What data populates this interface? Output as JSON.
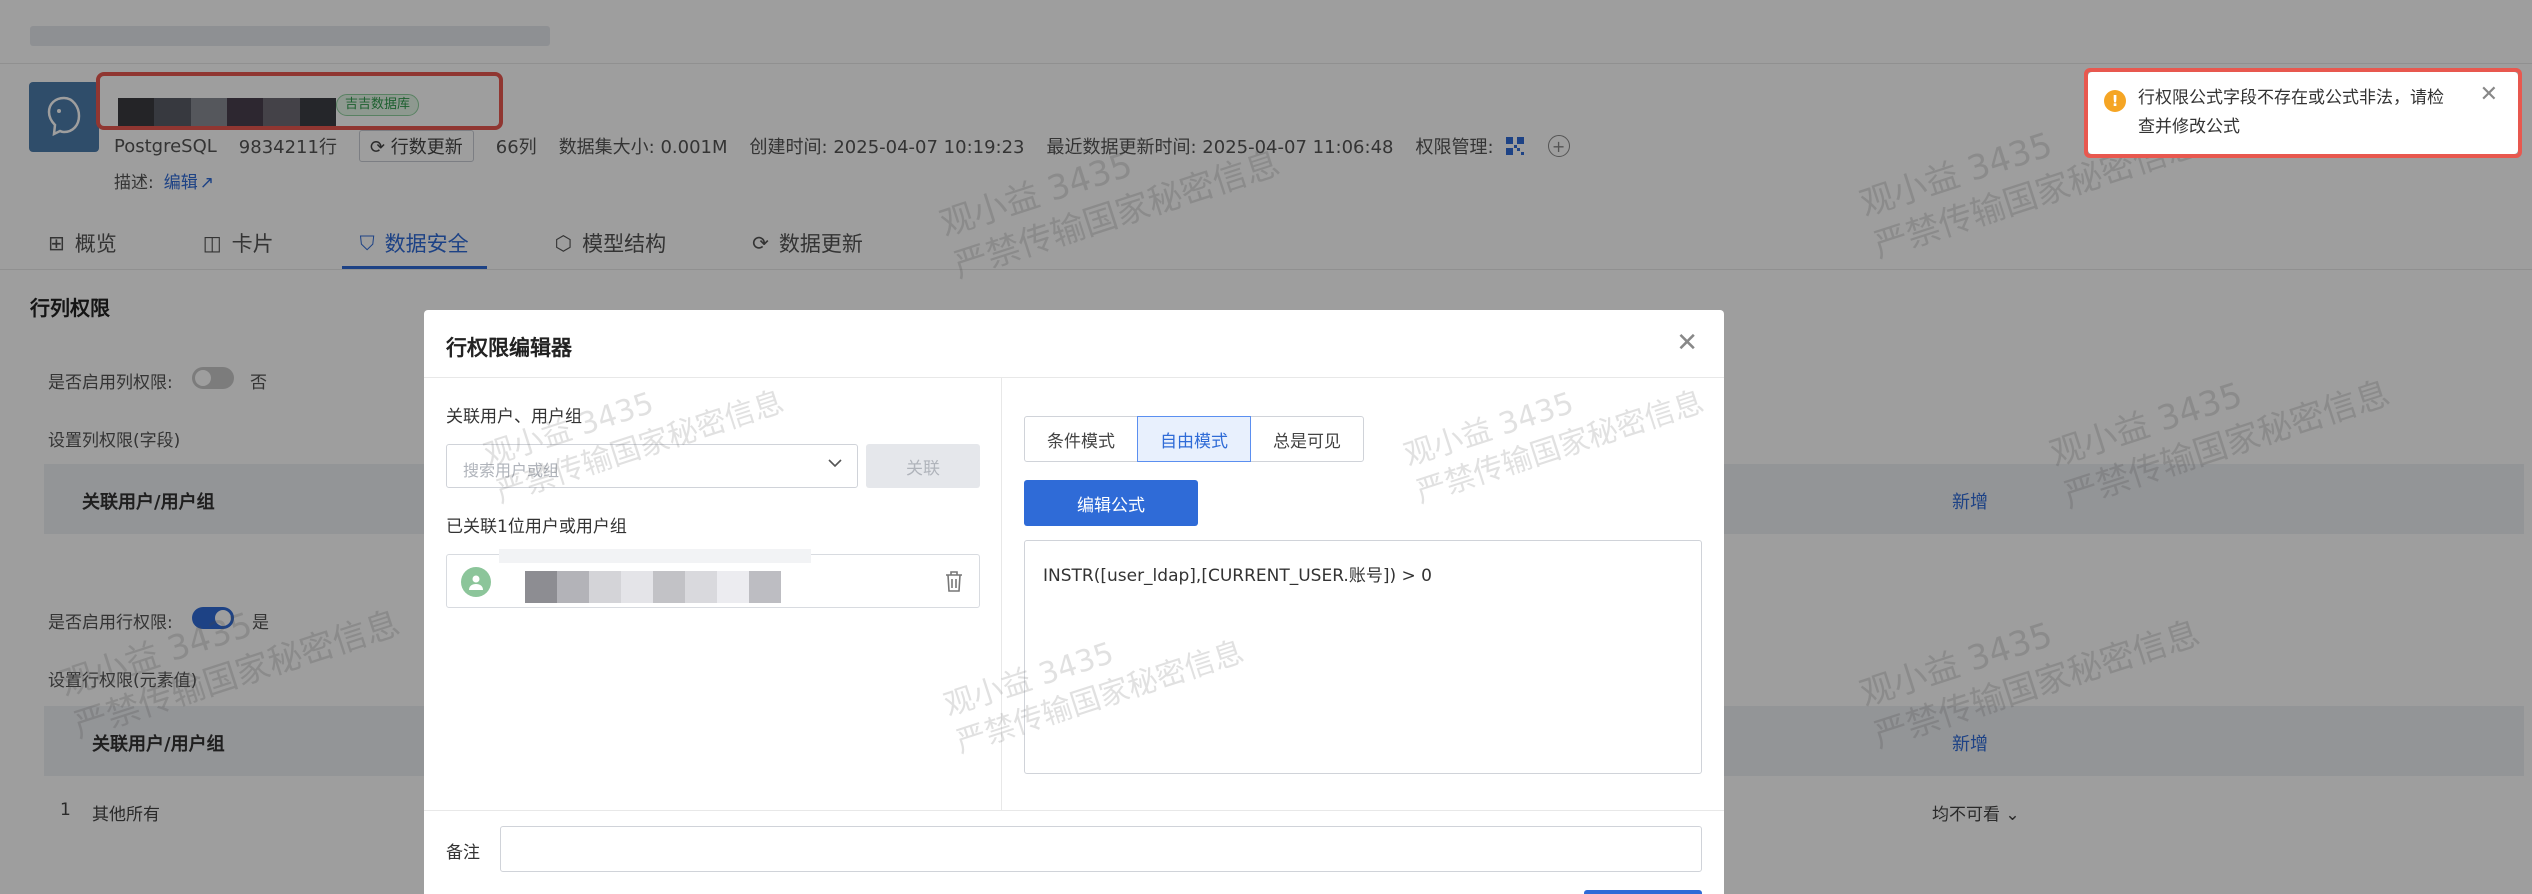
{
  "header": {
    "db_badge": "吉吉数据库",
    "meta": {
      "db_type": "PostgreSQL",
      "rows": "9834211行",
      "update_rows_label": "行数更新",
      "cols": "66列",
      "size": "数据集大小: 0.001M",
      "created": "创建时间: 2025-04-07 10:19:23",
      "updated": "最近数据更新时间: 2025-04-07 11:06:48",
      "perm": "权限管理:"
    },
    "desc_label": "描述:",
    "desc_edit": "编辑"
  },
  "tabs": [
    {
      "label": "概览",
      "icon": "grid-icon"
    },
    {
      "label": "卡片",
      "icon": "chart-card-icon"
    },
    {
      "label": "数据安全",
      "icon": "shield-icon",
      "active": true
    },
    {
      "label": "模型结构",
      "icon": "cube-icon"
    },
    {
      "label": "数据更新",
      "icon": "refresh-icon"
    }
  ],
  "section": {
    "title": "行列权限",
    "col_enable_label": "是否启用列权限:",
    "col_enable_value": "否",
    "col_set_label": "设置列权限(字段)",
    "row_enable_label": "是否启用行权限:",
    "row_enable_value": "是",
    "row_set_label": "设置行权限(元素值)",
    "table_col_user": "关联用户/用户组",
    "table_col_add": "新增",
    "row1_index": "1",
    "row1_name": "其他所有",
    "row1_value": "均不可看"
  },
  "watermark": {
    "line1": "观小益 3435",
    "line2": "严禁传输国家秘密信息"
  },
  "modal": {
    "title": "行权限编辑器",
    "assoc_label": "关联用户、用户组",
    "search_placeholder": "搜索用户或组",
    "link_button": "关联",
    "linked_count": "已关联1位用户或用户组",
    "modes": [
      "条件模式",
      "自由模式",
      "总是可见"
    ],
    "active_mode": "自由模式",
    "edit_formula_button": "编辑公式",
    "formula": "INSTR([user_ldap],[CURRENT_USER.账号]) > 0",
    "remark_label": "备注"
  },
  "toast": {
    "message": "行权限公式字段不存在或公式非法，请检查并修改公式",
    "colors": {
      "warning": "#f5a524",
      "highlight": "#e8584f"
    }
  },
  "colors": {
    "accent": "#2f6bd7"
  }
}
